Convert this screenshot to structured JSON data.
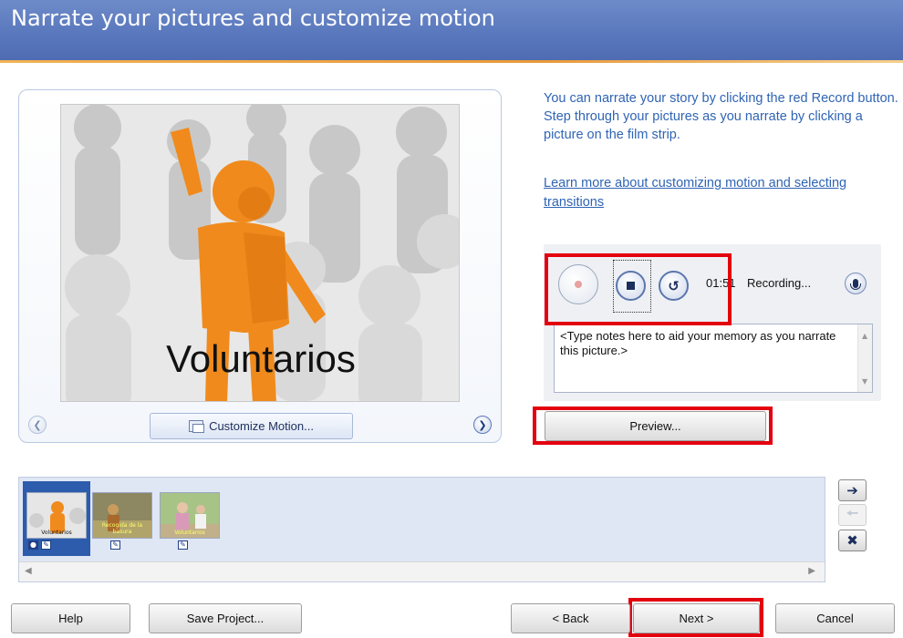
{
  "header": {
    "title": "Narrate your pictures and customize motion"
  },
  "preview": {
    "slide_caption": "Voluntarios",
    "customize_label": "Customize Motion..."
  },
  "info": {
    "instructions": "You can narrate your story by clicking the red Record button. Step through your pictures as you narrate by clicking a picture on the film strip.",
    "learn_more_link": "Learn more about customizing motion and selecting transitions"
  },
  "recording": {
    "timer": "01:51",
    "status": "Recording...",
    "notes_placeholder": "<Type notes here to aid your memory as you narrate this picture.>"
  },
  "preview_button": {
    "label": "Preview..."
  },
  "film_strip": {
    "thumbnails": [
      {
        "label": "Voluntarios",
        "selected": true,
        "has_narration": true
      },
      {
        "label": "Recogida de la basura",
        "selected": false,
        "has_narration": false
      },
      {
        "label": "Voluntarios",
        "selected": false,
        "has_narration": false
      }
    ]
  },
  "footer": {
    "help_label": "Help",
    "save_label": "Save Project...",
    "back_label": "< Back",
    "next_label": "Next >",
    "cancel_label": "Cancel"
  },
  "colors": {
    "header_bg": "#5a78bd",
    "link_blue": "#2f64b4",
    "highlight_red": "#e3000f",
    "figure_orange": "#f08a1c"
  },
  "icons": [
    "record-icon",
    "stop-icon",
    "undo-icon",
    "microphone-icon",
    "arrow-right-icon",
    "arrow-left-icon",
    "delete-icon",
    "customize-motion-icon"
  ]
}
